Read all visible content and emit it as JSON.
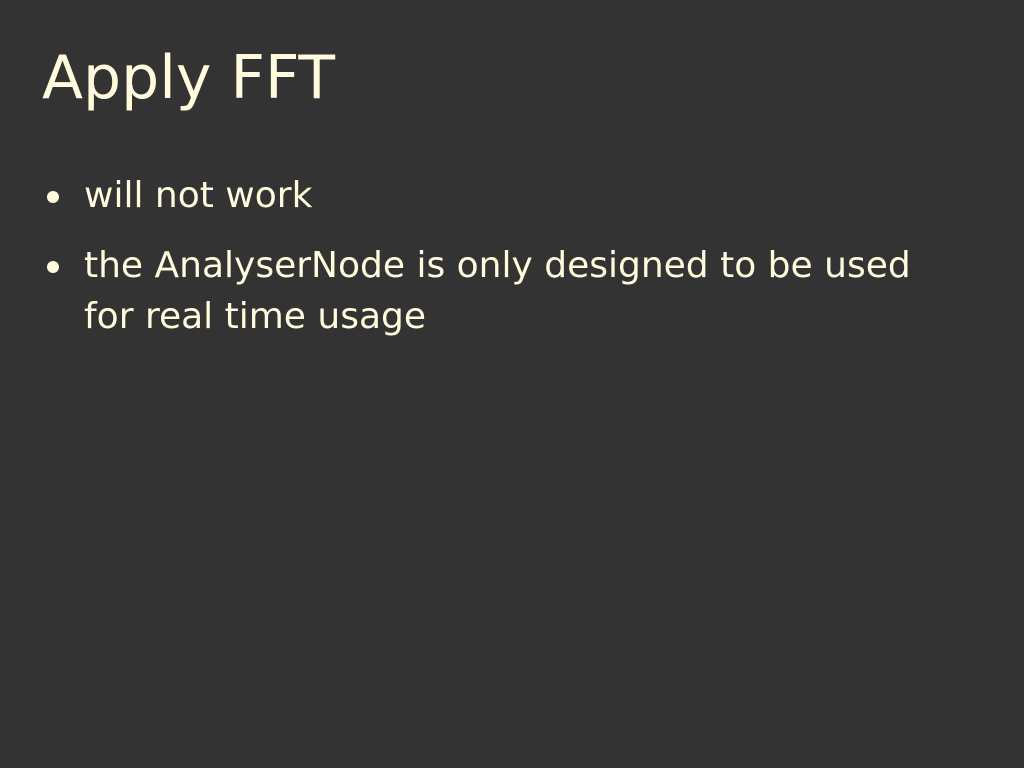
{
  "slide": {
    "title": "Apply FFT",
    "bullets": [
      "will not work",
      "the AnalyserNode is only designed to be used for real time usage"
    ]
  },
  "colors": {
    "background": "#333333",
    "text": "#fffbdc"
  }
}
